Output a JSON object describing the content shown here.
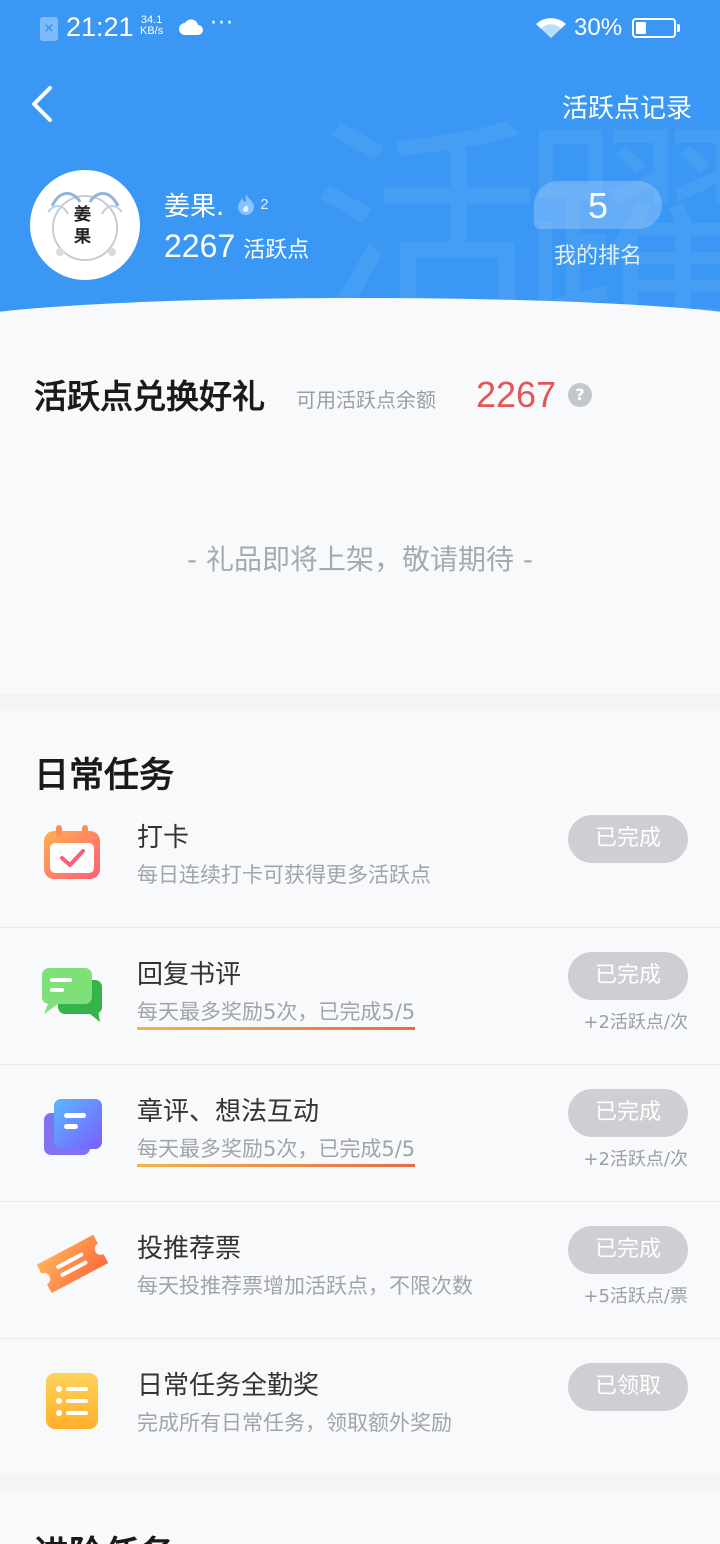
{
  "status_bar": {
    "time": "21:21",
    "net_speed_value": "34.1",
    "net_speed_unit": "KB/s",
    "dots": "···",
    "battery": "30%"
  },
  "header": {
    "record_link": "活跃点记录",
    "avatar_text": "姜果",
    "username": "姜果.",
    "level": "2",
    "points": "2267",
    "points_unit": "活跃点",
    "rank": "5",
    "rank_label": "我的排名"
  },
  "exchange": {
    "title": "活跃点兑换好礼",
    "balance_label": "可用活跃点余额",
    "balance": "2267",
    "help": "?",
    "empty_text": "- 礼品即将上架，敬请期待 -"
  },
  "daily": {
    "title": "日常任务",
    "tasks": [
      {
        "icon": "calendar-check-icon",
        "name": "打卡",
        "desc": "每日连续打卡可获得更多活跃点",
        "button": "已完成",
        "reward": ""
      },
      {
        "icon": "chat-bubbles-icon",
        "name": "回复书评",
        "desc": "每天最多奖励5次，已完成5/5",
        "button": "已完成",
        "reward": "+2活跃点/次"
      },
      {
        "icon": "document-stack-icon",
        "name": "章评、想法互动",
        "desc": "每天最多奖励5次，已完成5/5",
        "button": "已完成",
        "reward": "+2活跃点/次"
      },
      {
        "icon": "ticket-icon",
        "name": "投推荐票",
        "desc": "每天投推荐票增加活跃点，不限次数",
        "button": "已完成",
        "reward": "+5活跃点/票"
      },
      {
        "icon": "list-icon",
        "name": "日常任务全勤奖",
        "desc": "完成所有日常任务，领取额外奖励",
        "button": "已领取",
        "reward": ""
      }
    ]
  },
  "advanced": {
    "title": "进阶任务"
  },
  "colors": {
    "header_blue": "#3a97f4",
    "balance_red": "#e35656",
    "button_gray": "#cdcfd3"
  }
}
